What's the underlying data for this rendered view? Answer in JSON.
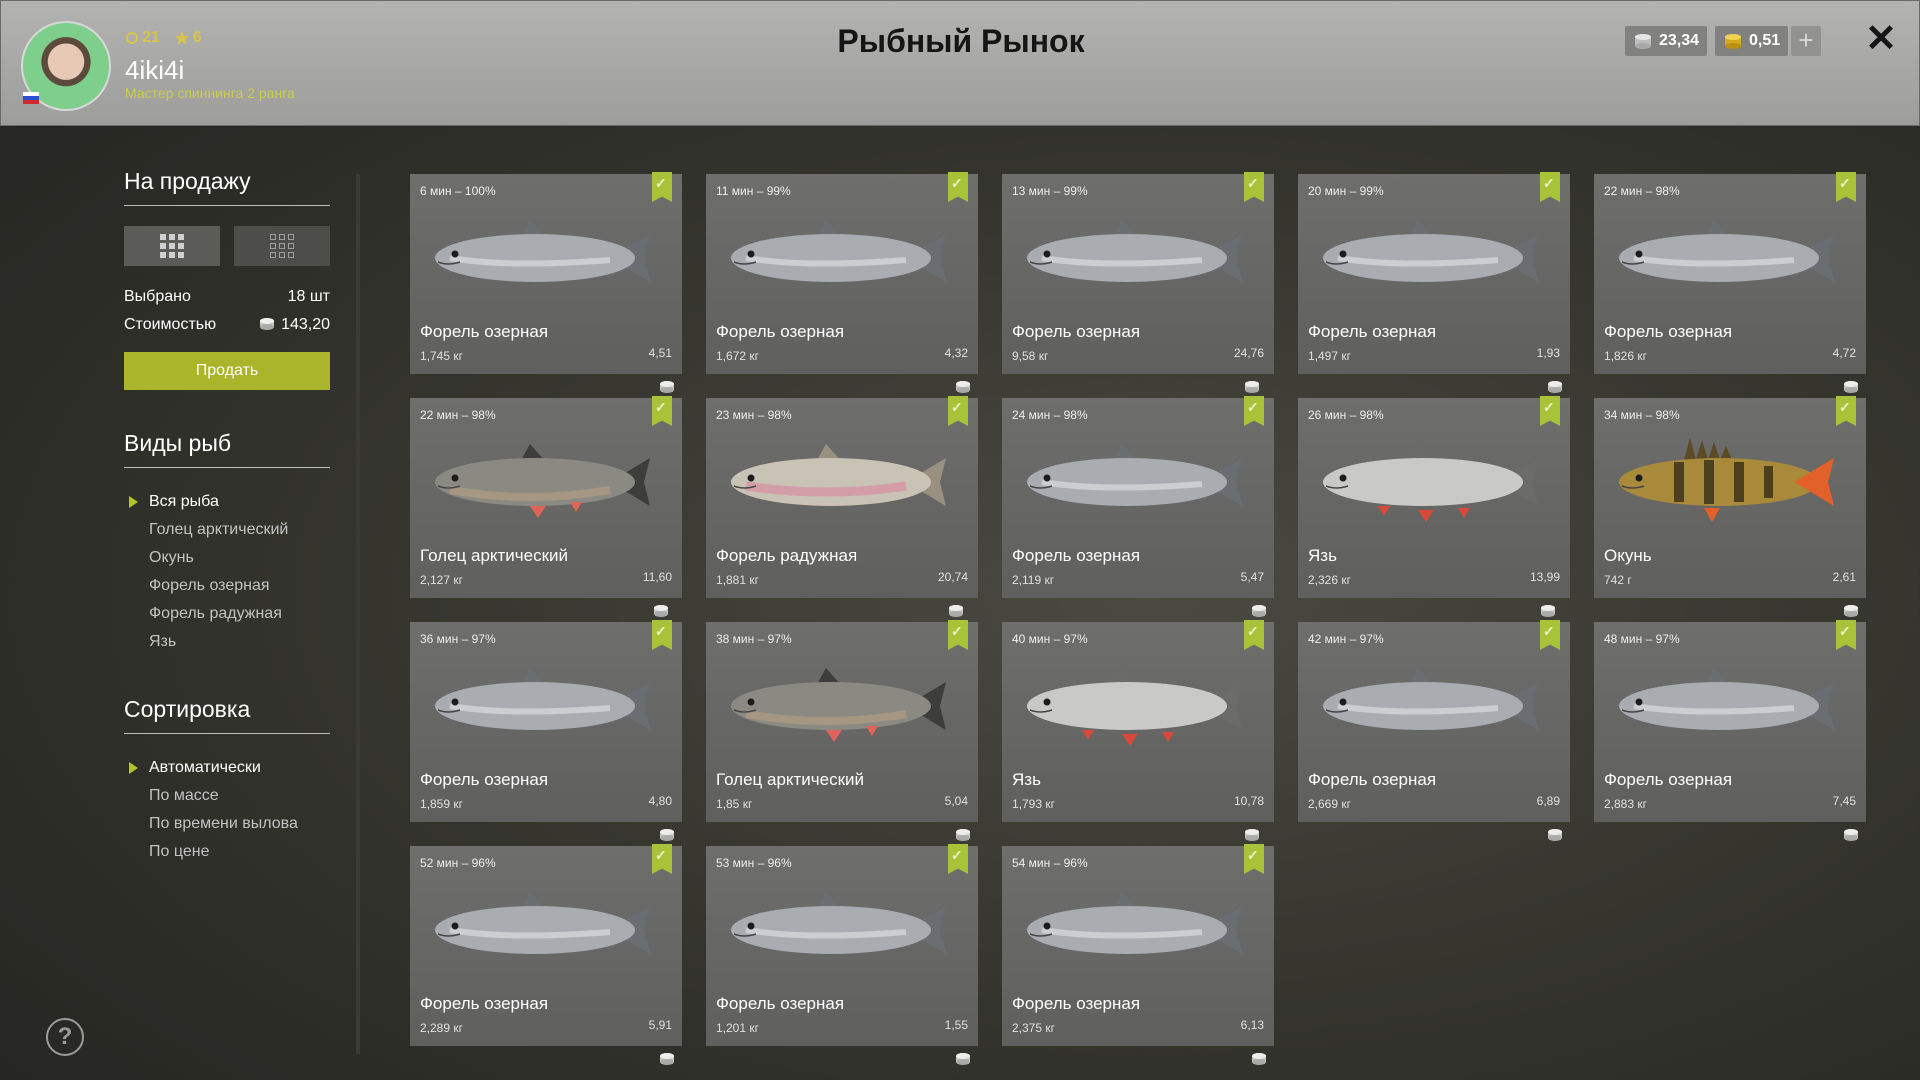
{
  "header": {
    "title": "Рыбный Рынок",
    "level": "21",
    "stars": "6",
    "username": "4iki4i",
    "rank": "Мастер спиннинга 2 ранга",
    "silver": "23,34",
    "gold": "0,51",
    "plus": "+",
    "close": "✕"
  },
  "sidebar": {
    "sale_title": "На продажу",
    "selected_label": "Выбрано",
    "selected_value": "18 шт",
    "cost_label": "Стоимостью",
    "cost_value": "143,20",
    "sell_button": "Продать",
    "species_title": "Виды рыб",
    "species": [
      "Вся рыба",
      "Голец арктический",
      "Окунь",
      "Форель озерная",
      "Форель радужная",
      "Язь"
    ],
    "species_active": 0,
    "sort_title": "Сортировка",
    "sort": [
      "Автоматически",
      "По массе",
      "По времени вылова",
      "По цене"
    ],
    "sort_active": 0,
    "help": "?"
  },
  "cards": [
    {
      "time": "6 мин – 100%",
      "name": "Форель озерная",
      "weight": "1,745 кг",
      "price": "4,51",
      "kind": "trout"
    },
    {
      "time": "11 мин – 99%",
      "name": "Форель озерная",
      "weight": "1,672 кг",
      "price": "4,32",
      "kind": "trout"
    },
    {
      "time": "13 мин – 99%",
      "name": "Форель озерная",
      "weight": "9,58 кг",
      "price": "24,76",
      "kind": "trout"
    },
    {
      "time": "20 мин – 99%",
      "name": "Форель озерная",
      "weight": "1,497 кг",
      "price": "1,93",
      "kind": "trout"
    },
    {
      "time": "22 мин – 98%",
      "name": "Форель озерная",
      "weight": "1,826 кг",
      "price": "4,72",
      "kind": "trout"
    },
    {
      "time": "22 мин – 98%",
      "name": "Голец арктический",
      "weight": "2,127 кг",
      "price": "11,60",
      "kind": "char"
    },
    {
      "time": "23 мин – 98%",
      "name": "Форель радужная",
      "weight": "1,881 кг",
      "price": "20,74",
      "kind": "rainbow"
    },
    {
      "time": "24 мин – 98%",
      "name": "Форель озерная",
      "weight": "2,119 кг",
      "price": "5,47",
      "kind": "trout"
    },
    {
      "time": "26 мин – 98%",
      "name": "Язь",
      "weight": "2,326 кг",
      "price": "13,99",
      "kind": "ide"
    },
    {
      "time": "34 мин – 98%",
      "name": "Окунь",
      "weight": "742 г",
      "price": "2,61",
      "kind": "perch"
    },
    {
      "time": "36 мин – 97%",
      "name": "Форель озерная",
      "weight": "1,859 кг",
      "price": "4,80",
      "kind": "trout"
    },
    {
      "time": "38 мин – 97%",
      "name": "Голец арктический",
      "weight": "1,85 кг",
      "price": "5,04",
      "kind": "char"
    },
    {
      "time": "40 мин – 97%",
      "name": "Язь",
      "weight": "1,793 кг",
      "price": "10,78",
      "kind": "ide"
    },
    {
      "time": "42 мин – 97%",
      "name": "Форель озерная",
      "weight": "2,669 кг",
      "price": "6,89",
      "kind": "trout"
    },
    {
      "time": "48 мин – 97%",
      "name": "Форель озерная",
      "weight": "2,883 кг",
      "price": "7,45",
      "kind": "trout"
    },
    {
      "time": "52 мин – 96%",
      "name": "Форель озерная",
      "weight": "2,289 кг",
      "price": "5,91",
      "kind": "trout"
    },
    {
      "time": "53 мин – 96%",
      "name": "Форель озерная",
      "weight": "1,201 кг",
      "price": "1,55",
      "kind": "trout"
    },
    {
      "time": "54 мин – 96%",
      "name": "Форель озерная",
      "weight": "2,375 кг",
      "price": "6,13",
      "kind": "trout"
    }
  ],
  "colors": {
    "accent": "#aab52c",
    "check": "#a8c23a",
    "stat": "#d9c44a",
    "rank": "#c9cf4a"
  }
}
